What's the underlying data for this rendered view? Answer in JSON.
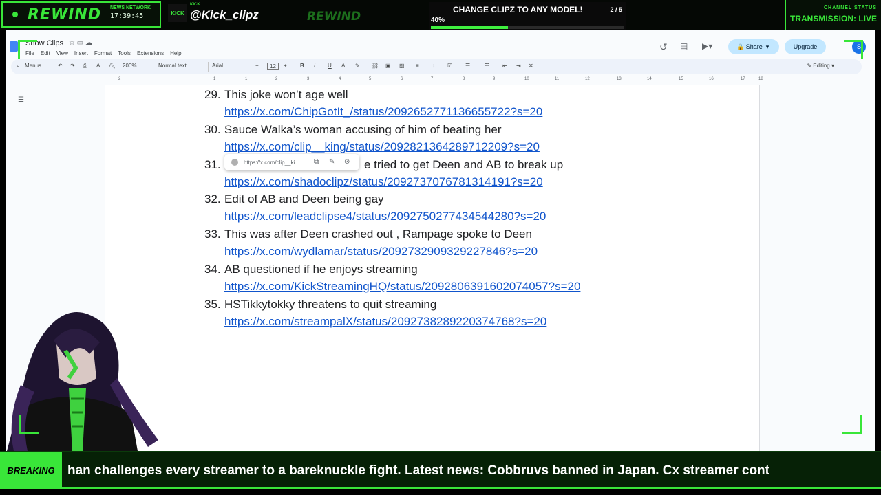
{
  "overlay": {
    "logo": "REWIND",
    "network": "NEWS NETWORK",
    "clock": "17:39:45",
    "kick_badge": "KICK",
    "kick_sub": "KICK",
    "handle": "@Kick_clipz",
    "ghost_logo": "REWIND",
    "challenge": {
      "title": "CHANGE CLIPZ TO ANY MODEL!",
      "count": "2 / 5",
      "percent_label": "40%",
      "progress": 0.4
    },
    "status_label": "CHANNEL STATUS",
    "status_value": "TRANSMISSION: LIVE",
    "accent": "#39e639"
  },
  "docs": {
    "title": "Show Clips",
    "menu": [
      "File",
      "Edit",
      "View",
      "Insert",
      "Format",
      "Tools",
      "Extensions",
      "Help"
    ],
    "share_label": "Share",
    "upgrade_label": "Upgrade",
    "avatar_initial": "S",
    "toolbar": {
      "menus": "Menus",
      "zoom": "200%",
      "style": "Normal text",
      "font": "Arial",
      "size": "12",
      "mode": "Editing"
    },
    "ruler": [
      "2",
      "1",
      "1",
      "2",
      "3",
      "4",
      "5",
      "6",
      "7",
      "8",
      "9",
      "10",
      "11",
      "12",
      "13",
      "14",
      "15",
      "16",
      "17",
      "18"
    ],
    "entries": [
      {
        "num": "29.",
        "title": "This joke won’t age well",
        "link": "https://x.com/ChipGotIt_/status/2092652771136655722?s=20"
      },
      {
        "num": "30.",
        "title": "Sauce Walka’s woman accusing of him of beating her",
        "link": "https://x.com/clip__king/status/2092821364289712209?s=20"
      },
      {
        "num": "31.",
        "title": "e tried to get Deen and AB to break up",
        "link": "https://x.com/shadoclipz/status/2092737076781314191?s=20"
      },
      {
        "num": "32.",
        "title": "Edit of AB and Deen being gay",
        "link": "https://x.com/leadclipse4/status/2092750277434544280?s=20"
      },
      {
        "num": "33.",
        "title": "This was after Deen crashed out , Rampage spoke to Deen",
        "link": "https://x.com/wydlamar/status/2092732909329227846?s=20"
      },
      {
        "num": "34.",
        "title": "AB questioned if he enjoys streaming",
        "link": "https://x.com/KickStreamingHQ/status/2092806391602074057?s=20"
      },
      {
        "num": "35.",
        "title": "HSTikkytokky threatens to quit streaming",
        "link": "https://x.com/streampalX/status/2092738289220374768?s=20"
      }
    ],
    "link_popup": {
      "url": "https://x.com/clip__ki..."
    },
    "link_color": "#1155cc"
  },
  "ticker": {
    "label": "BREAKING",
    "text": "han challenges every streamer to a bareknuckle fight. Latest news: Cobbruvs banned in Japan. Cx streamer cont"
  }
}
